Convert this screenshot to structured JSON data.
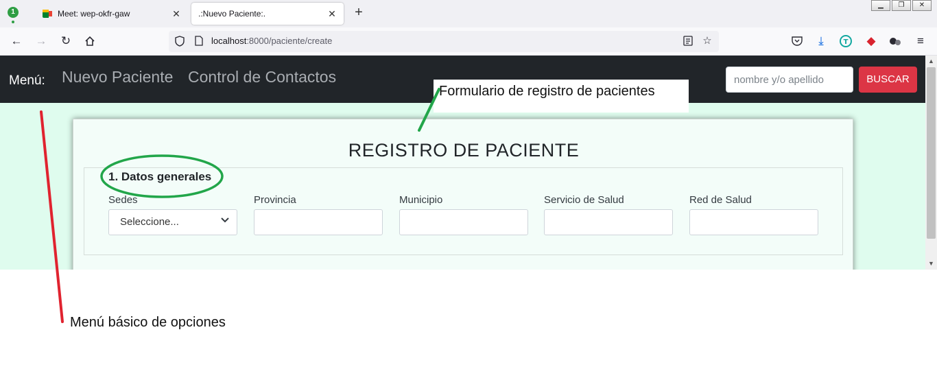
{
  "browser": {
    "tabs": [
      {
        "label": "Meet: wep-okfr-gaw"
      },
      {
        "label": ".:Nuevo Paciente:."
      }
    ],
    "tab_badge": "1",
    "url_host": "localhost",
    "url_rest": ":8000/paciente/create",
    "window_buttons": [
      "▁",
      "❐",
      "✕"
    ]
  },
  "site": {
    "brand": "Menú:",
    "nav_links": [
      "Nuevo Paciente",
      "Control de Contactos"
    ],
    "search": {
      "placeholder": "nombre y/o apellido",
      "button": "BUSCAR"
    }
  },
  "form": {
    "title": "REGISTRO DE PACIENTE",
    "section_title": "1. Datos generales",
    "fields": [
      {
        "label": "Sedes",
        "value": "Seleccione..."
      },
      {
        "label": "Provincia",
        "value": ""
      },
      {
        "label": "Municipio",
        "value": ""
      },
      {
        "label": "Servicio de Salud",
        "value": ""
      },
      {
        "label": "Red de Salud",
        "value": ""
      }
    ]
  },
  "annotations": {
    "form_note": "Formulario de registro de pacientes",
    "menu_note": "Menú básico de  opciones",
    "colors": {
      "red_line": "#e0232f",
      "green_line": "#22a64a"
    }
  },
  "theme": {
    "navbar_bg": "#212529",
    "page_bg": "#dffcee",
    "danger": "#dc3545"
  }
}
